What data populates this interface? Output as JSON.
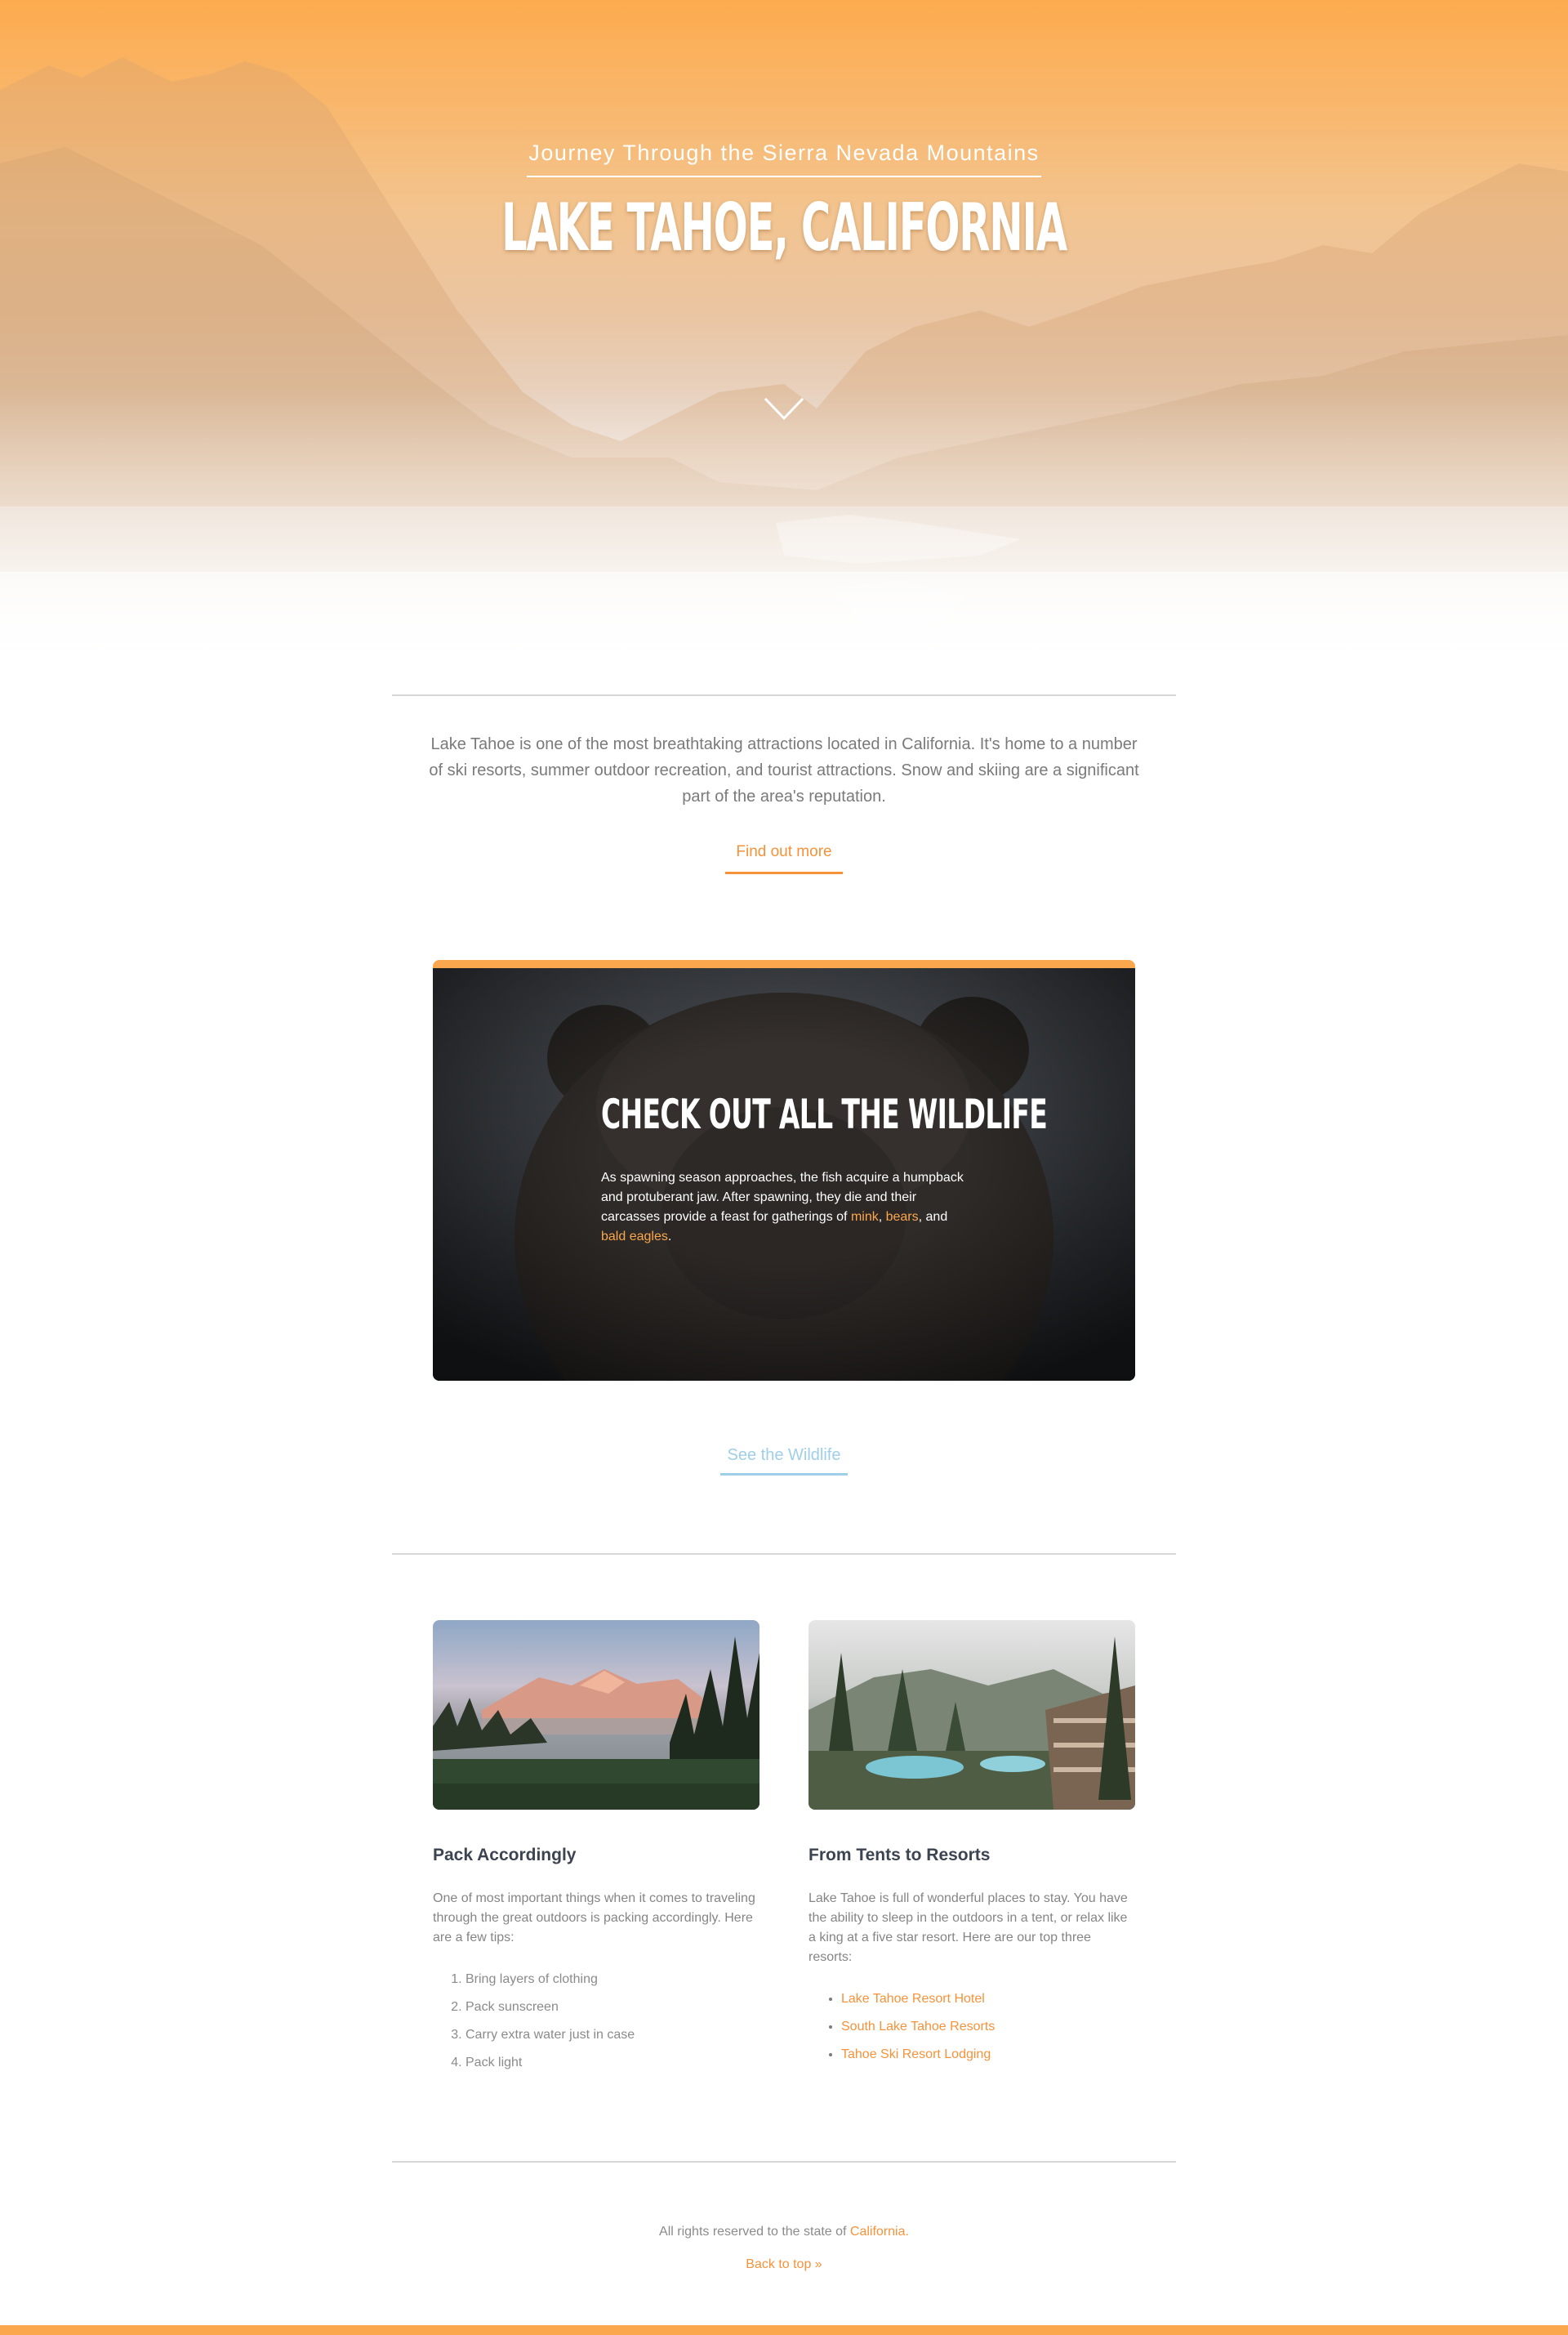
{
  "hero": {
    "subtitle": "Journey Through the Sierra Nevada Mountains",
    "title": "LAKE TAHOE, CALIFORNIA",
    "scroll_icon": "chevron-down-icon"
  },
  "intro": {
    "text": "Lake Tahoe is one of the most breathtaking attractions located in California. It's home to a number of ski resorts, summer outdoor recreation, and tourist attractions. Snow and skiing are a significant part of the area's reputation.",
    "button_label": "Find out more"
  },
  "wildlife": {
    "title": "CHECK OUT ALL THE WILDLIFE",
    "text_before": "As spawning season approaches, the fish acquire a humpback and protuberant jaw. After spawning, they die and their carcasses provide a feast for gatherings of ",
    "link1": "mink",
    "sep1": ", ",
    "link2": "bears",
    "sep2": ", and ",
    "link3": "bald eagles",
    "text_after": ".",
    "button_label": "See the Wildlife"
  },
  "pack": {
    "heading": "Pack Accordingly",
    "text": "One of most important things when it comes to traveling through the great outdoors is packing accordingly. Here are a few tips:",
    "tips": [
      "Bring layers of clothing",
      "Pack sunscreen",
      "Carry extra water just in case",
      "Pack light"
    ]
  },
  "stay": {
    "heading": "From Tents to Resorts",
    "text": "Lake Tahoe is full of wonderful places to stay. You have the ability to sleep in the outdoors in a tent, or relax like a king at a five star resort. Here are our top three resorts:",
    "resorts": [
      "Lake Tahoe Resort Hotel",
      "South Lake Tahoe Resorts",
      "Tahoe Ski Resort Lodging"
    ]
  },
  "footer": {
    "text": "All rights reserved to the state of ",
    "link": "California",
    "period": ".",
    "back_to_top": "Back to top »"
  },
  "colors": {
    "accent": "#f6923a",
    "accent_light": "#fba74d",
    "link_blue": "#9fcfe8",
    "heading": "#3c4452"
  }
}
